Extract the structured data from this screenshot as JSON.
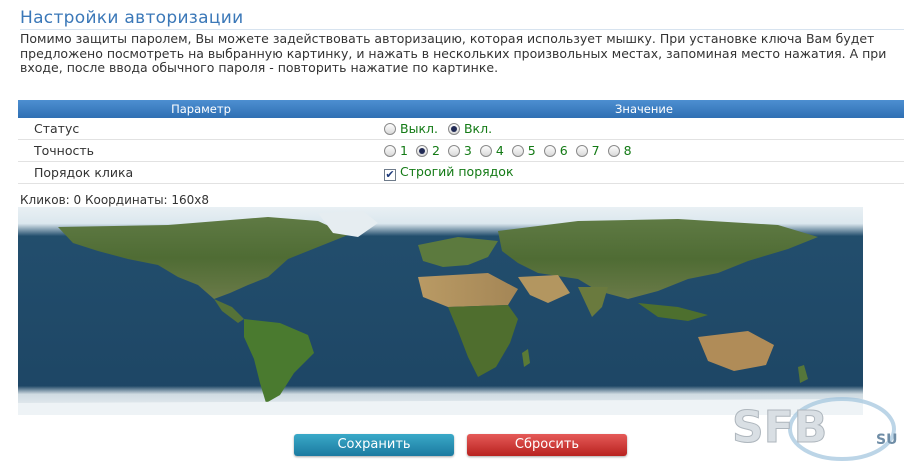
{
  "page": {
    "title": "Настройки авторизации",
    "description": "Помимо защиты паролем, Вы можете задействовать авторизацию, которая использует мышку. При установке ключа Вам будет предложено посмотреть на выбранную картинку, и нажать в нескольких произвольных местах, запоминая место нажатия. А при входе, после ввода обычного пароля - повторить нажатие по картинке."
  },
  "table": {
    "col_param": "Параметр",
    "col_value": "Значение",
    "status": {
      "label": "Статус",
      "options": [
        "Выкл.",
        "Вкл."
      ],
      "selected": "Вкл."
    },
    "accuracy": {
      "label": "Точность",
      "options": [
        "1",
        "2",
        "3",
        "4",
        "5",
        "6",
        "7",
        "8"
      ],
      "selected": "2"
    },
    "order": {
      "label": "Порядок клика",
      "checkbox_label": "Строгий порядок",
      "checked": true
    }
  },
  "clicks_text": "Кликов: 0 Координаты: 160x8",
  "buttons": {
    "save": "Сохранить",
    "reset": "Сбросить"
  },
  "watermark": {
    "logo_text": "SFB",
    "suffix": "SU"
  },
  "colors": {
    "accent": "#3b78b8",
    "header_bg": "#2f6fb3",
    "value_text": "#137a15",
    "save_button": "#1b7aa0",
    "reset_button": "#b8221f"
  }
}
